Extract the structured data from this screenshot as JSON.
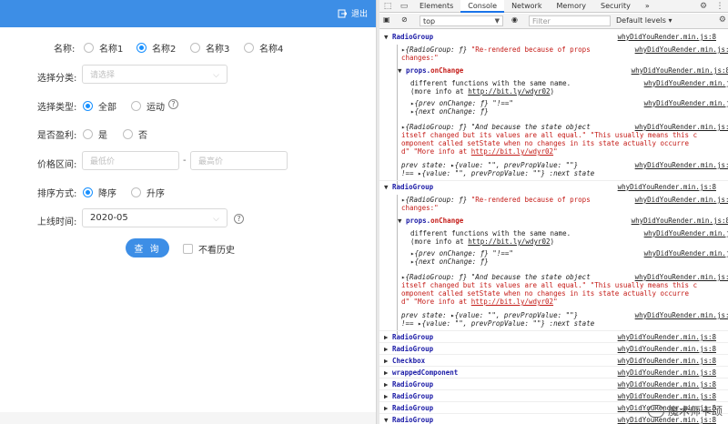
{
  "header": {
    "logout_label": "退出"
  },
  "form": {
    "name_label": "名称:",
    "names": [
      "名称1",
      "名称2",
      "名称3",
      "名称4"
    ],
    "category_label": "选择分类:",
    "category_placeholder": "请选择",
    "type_label": "选择类型:",
    "types": [
      "全部",
      "运动"
    ],
    "profit_label": "是否盈利:",
    "profit_options": [
      "是",
      "否"
    ],
    "price_label": "价格区间:",
    "price_min_placeholder": "最低价",
    "price_max_placeholder": "最高价",
    "sort_label": "排序方式:",
    "sort_options": [
      "降序",
      "升序"
    ],
    "date_label": "上线时间:",
    "date_value": "2020-05",
    "query_label": "查 询",
    "history_label": "不看历史"
  },
  "devtools": {
    "tabs": [
      "Elements",
      "Console",
      "Network",
      "Memory",
      "Security"
    ],
    "more": "»",
    "context": "top",
    "filter_placeholder": "Filter",
    "levels": "Default levels ▾",
    "source": "whyDidYouRender.min.js:8",
    "group1": {
      "title": "RadioGroup",
      "msg1a": "{RadioGroup: ƒ}",
      "msg1b": "\"Re-rendered because of props",
      "msg1c": "changes:\"",
      "prop_prefix": "props.",
      "prop_name": "onChange",
      "diff1": "different functions with the same name.",
      "diff2": "(more info at ",
      "diff2_link": "http://bit.ly/wdyr02",
      "diff2_end": ")",
      "prev": "{prev onChange: ƒ} \"!==\"",
      "next": "{next onChange: ƒ}",
      "eq1": "{RadioGroup: ƒ} \"And because the state object",
      "eq2": "itself changed but its values are all equal.\" \"This usually means this c",
      "eq3": "omponent called setState when no changes in its state actually occurre",
      "eq4a": "d\" \"More info at ",
      "eq4_link": "http://bit.ly/wdyr02",
      "eq4b": "\"",
      "ps1": "prev state: ▸{value: \"\", prevPropValue: \"\"}",
      "ps2": "!==  ▸{value: \"\", prevPropValue: \"\"} :next state"
    },
    "collapsed": [
      "RadioGroup",
      "RadioGroup",
      "Checkbox",
      "wrappedComponent",
      "RadioGroup",
      "RadioGroup",
      "RadioGroup",
      "RadioGroup"
    ],
    "watermark": "魔术师卡颂"
  },
  "colors": {
    "primary": "#3d8ee6",
    "radio": "#1890ff",
    "console_blue": "#1a1aa6",
    "console_red": "#c41a16"
  }
}
